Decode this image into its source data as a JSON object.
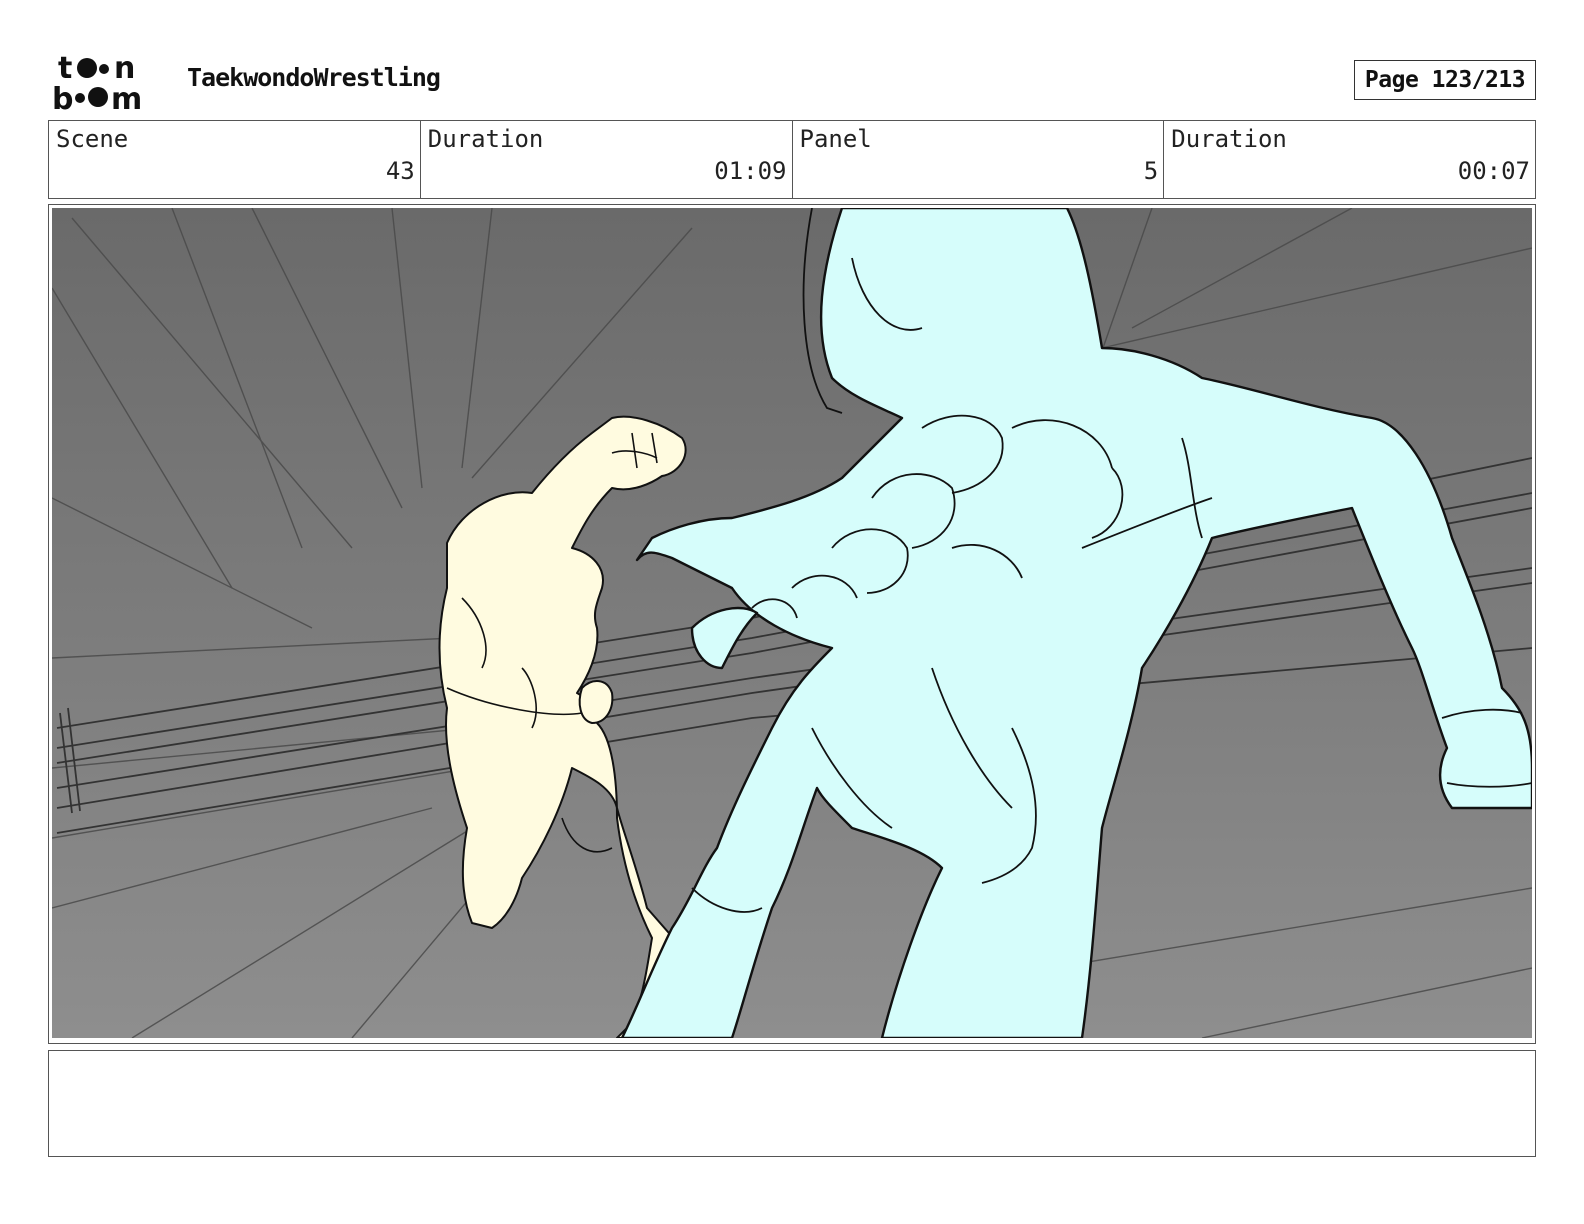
{
  "header": {
    "logo": {
      "top": "t●n",
      "bottom": "b●●m",
      "brand": "toon boom"
    },
    "project_title": "TaekwondoWrestling",
    "page_label": "Page 123/213"
  },
  "info_bar": {
    "cells": [
      {
        "label": "Scene",
        "value": "43"
      },
      {
        "label": "Duration",
        "value": "01:09"
      },
      {
        "label": "Panel",
        "value": "5"
      },
      {
        "label": "Duration",
        "value": "00:07"
      }
    ]
  },
  "panel": {
    "colors": {
      "background_top": "#6a6a6a",
      "background_bottom": "#8e8e8e",
      "near_character": "#d6fdfb",
      "far_character": "#fffbe0",
      "line": "#111111"
    }
  },
  "notes": {
    "text": ""
  }
}
